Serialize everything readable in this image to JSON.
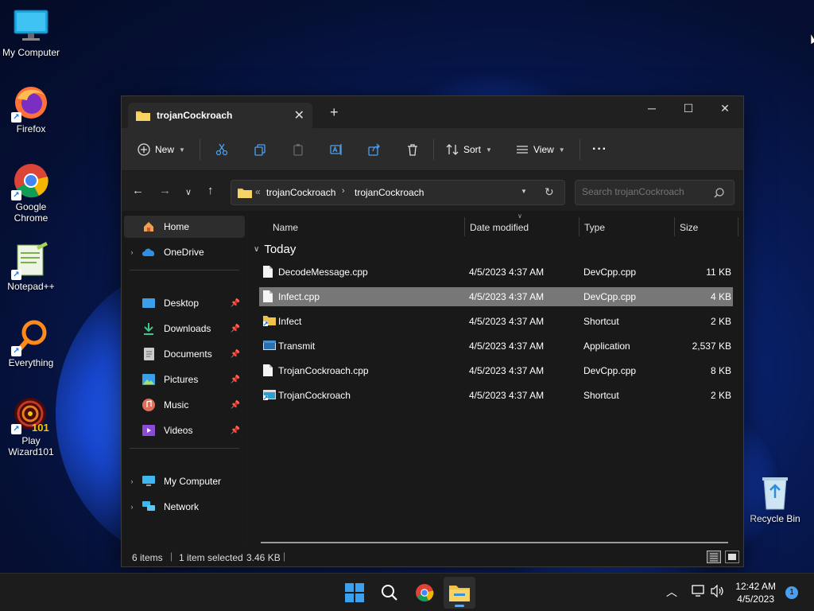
{
  "desktop": {
    "icons": [
      {
        "label": "My Computer",
        "icon": "monitor-icon"
      },
      {
        "label": "Firefox",
        "icon": "firefox-icon"
      },
      {
        "label": "Google Chrome",
        "icon": "chrome-icon"
      },
      {
        "label": "Notepad++",
        "icon": "notepadpp-icon"
      },
      {
        "label": "Everything",
        "icon": "magnifier-icon"
      },
      {
        "label": "Play Wizard101",
        "icon": "wizard101-icon"
      },
      {
        "label": "Recycle Bin",
        "icon": "recycle-bin-icon"
      }
    ]
  },
  "window": {
    "tab_title": "trojanCockroach",
    "toolbar": {
      "new_label": "New",
      "sort_label": "Sort",
      "view_label": "View"
    },
    "address": {
      "prefix": "«",
      "crumbs": [
        "trojanCockroach",
        "trojanCockroach"
      ],
      "search_placeholder": "Search trojanCockroach"
    },
    "sidebar": {
      "items": [
        {
          "label": "Home",
          "icon": "home-icon",
          "selected": true
        },
        {
          "label": "OneDrive",
          "icon": "cloud-icon",
          "expandable": true
        },
        {
          "label": "Desktop",
          "icon": "desktop-folder-icon",
          "pinned": true
        },
        {
          "label": "Downloads",
          "icon": "download-icon",
          "pinned": true
        },
        {
          "label": "Documents",
          "icon": "documents-icon",
          "pinned": true
        },
        {
          "label": "Pictures",
          "icon": "pictures-icon",
          "pinned": true
        },
        {
          "label": "Music",
          "icon": "music-icon",
          "pinned": true
        },
        {
          "label": "Videos",
          "icon": "videos-icon",
          "pinned": true
        },
        {
          "label": "My Computer",
          "icon": "computer-icon",
          "expandable": true
        },
        {
          "label": "Network",
          "icon": "network-icon",
          "expandable": true
        }
      ]
    },
    "columns": {
      "name": "Name",
      "date": "Date modified",
      "type": "Type",
      "size": "Size"
    },
    "group_label": "Today",
    "files": [
      {
        "name": "DecodeMessage.cpp",
        "date": "4/5/2023 4:37 AM",
        "type": "DevCpp.cpp",
        "size": "11 KB",
        "icon": "file-icon"
      },
      {
        "name": "Infect.cpp",
        "date": "4/5/2023 4:37 AM",
        "type": "DevCpp.cpp",
        "size": "4 KB",
        "icon": "file-icon",
        "selected": true
      },
      {
        "name": "Infect",
        "date": "4/5/2023 4:37 AM",
        "type": "Shortcut",
        "size": "2 KB",
        "icon": "folder-shortcut-icon"
      },
      {
        "name": "Transmit",
        "date": "4/5/2023 4:37 AM",
        "type": "Application",
        "size": "2,537 KB",
        "icon": "application-icon"
      },
      {
        "name": "TrojanCockroach.cpp",
        "date": "4/5/2023 4:37 AM",
        "type": "DevCpp.cpp",
        "size": "8 KB",
        "icon": "file-icon"
      },
      {
        "name": "TrojanCockroach",
        "date": "4/5/2023 4:37 AM",
        "type": "Shortcut",
        "size": "2 KB",
        "icon": "app-shortcut-icon"
      }
    ],
    "status": {
      "items": "6 items",
      "selection": "1 item selected",
      "selection_size": "3.46 KB"
    }
  },
  "taskbar": {
    "apps": [
      "start-icon",
      "search-icon",
      "chrome-icon",
      "file-explorer-icon"
    ],
    "time": "12:42 AM",
    "date": "4/5/2023",
    "notification_count": "1"
  },
  "colors": {
    "window_bg": "#191919",
    "toolbar_bg": "#2b2b2b",
    "selected_row": "#777777",
    "accent": "#62a8ec"
  }
}
